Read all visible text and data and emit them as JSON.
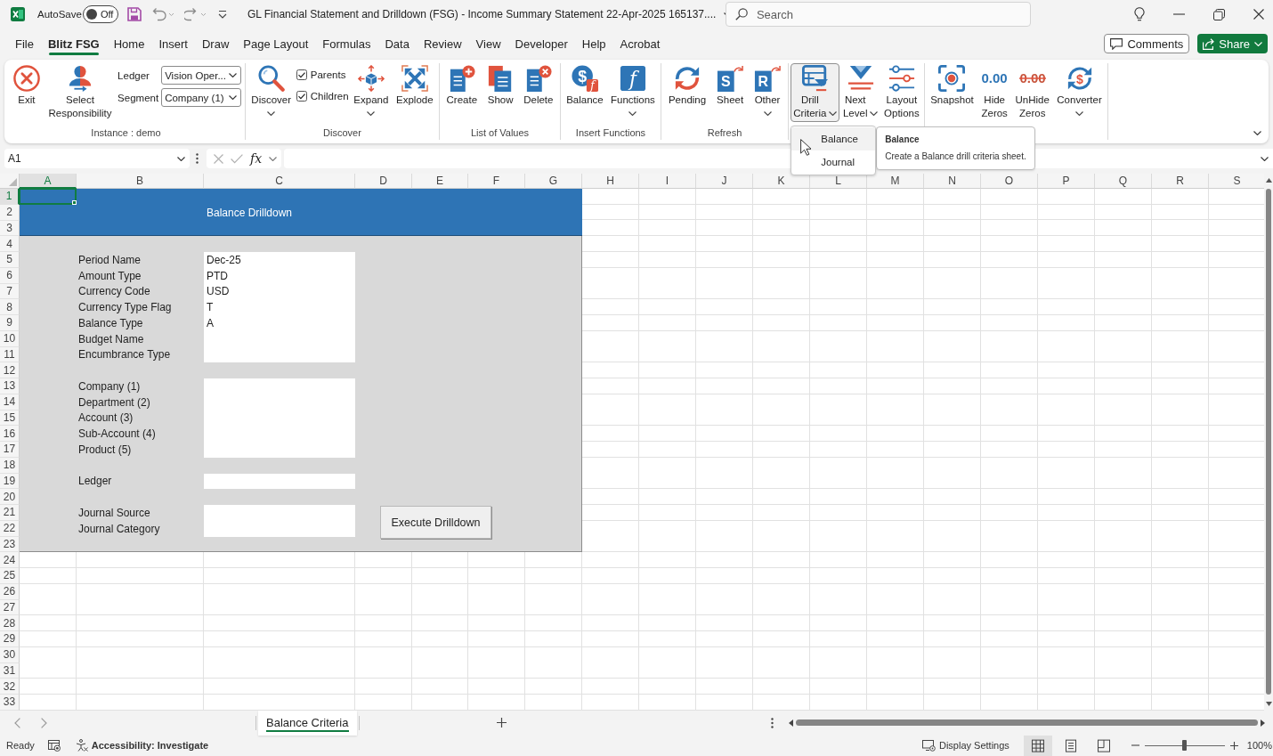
{
  "title_bar": {
    "autosave_label": "AutoSave",
    "autosave": {
      "label": "Off",
      "on": false
    },
    "title": "GL Financial Statement and Drilldown (FSG) - Income Summary Statement 22-Apr-2025 165137....",
    "search": {
      "placeholder": "Search"
    }
  },
  "menu_tabs": [
    {
      "label": "File",
      "selected": false
    },
    {
      "label": "Blitz FSG",
      "selected": true
    },
    {
      "label": "Home",
      "selected": false
    },
    {
      "label": "Insert",
      "selected": false
    },
    {
      "label": "Draw",
      "selected": false
    },
    {
      "label": "Page Layout",
      "selected": false
    },
    {
      "label": "Formulas",
      "selected": false
    },
    {
      "label": "Data",
      "selected": false
    },
    {
      "label": "Review",
      "selected": false
    },
    {
      "label": "View",
      "selected": false
    },
    {
      "label": "Developer",
      "selected": false
    },
    {
      "label": "Help",
      "selected": false
    },
    {
      "label": "Acrobat",
      "selected": false
    }
  ],
  "header_buttons": {
    "comments": "Comments",
    "share": "Share"
  },
  "ribbon": {
    "groups": [
      {
        "label": "Instance : demo",
        "items": [
          {
            "kind": "button",
            "label": "Exit",
            "expanded": false
          },
          {
            "kind": "button",
            "label": "Select Responsibility",
            "expanded": false
          },
          {
            "kind": "combos",
            "rows": [
              {
                "label": "Ledger",
                "value": "Vision Oper..."
              },
              {
                "label": "Segment",
                "value": "Company (1)"
              }
            ]
          }
        ]
      },
      {
        "label": "Discover",
        "items": [
          {
            "kind": "dropdown",
            "label": "Discover",
            "expanded": false
          },
          {
            "kind": "checks",
            "rows": [
              {
                "label": "Parents",
                "checked": true
              },
              {
                "label": "Children",
                "checked": true
              }
            ]
          },
          {
            "kind": "dropdown",
            "label": "Expand",
            "expanded": false
          },
          {
            "kind": "button",
            "label": "Explode",
            "expanded": false
          }
        ]
      },
      {
        "label": "List of Values",
        "items": [
          {
            "kind": "button",
            "label": "Create",
            "expanded": false
          },
          {
            "kind": "button",
            "label": "Show",
            "expanded": false
          },
          {
            "kind": "button",
            "label": "Delete",
            "expanded": false
          }
        ]
      },
      {
        "label": "Insert Functions",
        "items": [
          {
            "kind": "button",
            "label": "Balance",
            "expanded": false,
            "icon_glyphs": [
              "$",
              "f"
            ]
          },
          {
            "kind": "dropdown",
            "label": "Functions",
            "expanded": false,
            "icon_glyphs": [
              "f"
            ]
          }
        ]
      },
      {
        "label": "Refresh",
        "items": [
          {
            "kind": "button",
            "label": "Pending",
            "expanded": false
          },
          {
            "kind": "button",
            "label": "Sheet",
            "expanded": false,
            "icon_glyphs": [
              "S"
            ]
          },
          {
            "kind": "dropdown",
            "label": "Other",
            "expanded": false,
            "icon_glyphs": [
              "R"
            ]
          }
        ]
      },
      {
        "items": [
          {
            "kind": "dropdown_inline",
            "label": "Drill Criteria",
            "expanded": true,
            "menu": {
              "items": [
                {
                  "label": "Balance",
                  "selected": true
                },
                {
                  "label": "Journal",
                  "selected": false
                }
              ],
              "tooltip": {
                "title": "Balance",
                "text": "Create a Balance drill criteria sheet."
              }
            }
          },
          {
            "kind": "dropdown_inline",
            "label": "Next Level",
            "expanded": false
          },
          {
            "kind": "button",
            "label": "Layout Options",
            "expanded": false
          }
        ]
      },
      {
        "items": [
          {
            "kind": "button",
            "label": "Snapshot",
            "expanded": false
          },
          {
            "kind": "button",
            "label": "Hide Zeros",
            "expanded": false,
            "icon_glyphs": [
              "0.00"
            ]
          },
          {
            "kind": "button",
            "label": "UnHide Zeros",
            "expanded": false,
            "icon_glyphs": [
              "0.00"
            ]
          },
          {
            "kind": "dropdown",
            "label": "Converter",
            "expanded": false,
            "icon_glyphs": [
              "$"
            ]
          }
        ]
      }
    ]
  },
  "formula_bar": {
    "name_box": "A1",
    "function_button": "fx"
  },
  "sheet": {
    "columns": [
      {
        "label": "A",
        "selected": true
      },
      {
        "label": "B",
        "selected": false
      },
      {
        "label": "C",
        "selected": false
      },
      {
        "label": "D",
        "selected": false
      },
      {
        "label": "E",
        "selected": false
      },
      {
        "label": "F",
        "selected": false
      },
      {
        "label": "G",
        "selected": false
      },
      {
        "label": "H",
        "selected": false
      },
      {
        "label": "I",
        "selected": false
      },
      {
        "label": "J",
        "selected": false
      },
      {
        "label": "K",
        "selected": false
      },
      {
        "label": "L",
        "selected": false
      },
      {
        "label": "M",
        "selected": false
      },
      {
        "label": "N",
        "selected": false
      },
      {
        "label": "O",
        "selected": false
      },
      {
        "label": "P",
        "selected": false
      },
      {
        "label": "Q",
        "selected": false
      },
      {
        "label": "R",
        "selected": false
      },
      {
        "label": "S",
        "selected": false
      }
    ],
    "rows": [
      {
        "label": "1",
        "selected": true
      },
      {
        "label": "2",
        "selected": false
      },
      {
        "label": "3",
        "selected": false
      },
      {
        "label": "4",
        "selected": false
      },
      {
        "label": "5",
        "selected": false
      },
      {
        "label": "6",
        "selected": false
      },
      {
        "label": "7",
        "selected": false
      },
      {
        "label": "8",
        "selected": false
      },
      {
        "label": "9",
        "selected": false
      },
      {
        "label": "10",
        "selected": false
      },
      {
        "label": "11",
        "selected": false
      },
      {
        "label": "12",
        "selected": false
      },
      {
        "label": "13",
        "selected": false
      },
      {
        "label": "14",
        "selected": false
      },
      {
        "label": "15",
        "selected": false
      },
      {
        "label": "16",
        "selected": false
      },
      {
        "label": "17",
        "selected": false
      },
      {
        "label": "18",
        "selected": false
      },
      {
        "label": "19",
        "selected": false
      },
      {
        "label": "20",
        "selected": false
      },
      {
        "label": "21",
        "selected": false
      },
      {
        "label": "22",
        "selected": false
      },
      {
        "label": "23",
        "selected": false
      },
      {
        "label": "24",
        "selected": false
      },
      {
        "label": "25",
        "selected": false
      },
      {
        "label": "26",
        "selected": false
      },
      {
        "label": "27",
        "selected": false
      },
      {
        "label": "28",
        "selected": false
      },
      {
        "label": "29",
        "selected": false
      },
      {
        "label": "30",
        "selected": false
      },
      {
        "label": "31",
        "selected": false
      },
      {
        "label": "32",
        "selected": false
      },
      {
        "label": "33",
        "selected": false
      }
    ],
    "form": {
      "title": "Balance Drilldown",
      "field_groups": [
        {
          "fields": [
            {
              "label": "Period Name",
              "value": "Dec-25"
            },
            {
              "label": "Amount Type",
              "value": "PTD"
            },
            {
              "label": "Currency Code",
              "value": "USD"
            },
            {
              "label": "Currency Type Flag",
              "value": "T"
            },
            {
              "label": "Balance Type",
              "value": "A"
            },
            {
              "label": "Budget Name"
            },
            {
              "label": "Encumbrance Type"
            }
          ]
        },
        {
          "fields": [
            {
              "label": "Company (1)"
            },
            {
              "label": "Department (2)"
            },
            {
              "label": "Account (3)"
            },
            {
              "label": "Sub-Account (4)"
            },
            {
              "label": "Product (5)"
            }
          ]
        },
        {
          "fields": [
            {
              "label": "Ledger"
            }
          ]
        },
        {
          "fields": [
            {
              "label": "Journal Source"
            },
            {
              "label": "Journal Category"
            }
          ]
        }
      ],
      "execute_button": "Execute Drilldown"
    }
  },
  "sheet_tabs": [
    {
      "label": "Balance Criteria",
      "selected": true
    }
  ],
  "status_bar": {
    "status": "Ready",
    "accessibility": "Accessibility: Investigate",
    "display_settings": "Display Settings",
    "views": [
      {
        "kind": "normal",
        "selected": true
      },
      {
        "kind": "layout",
        "selected": false
      },
      {
        "kind": "pagebreak",
        "selected": false
      }
    ],
    "zoom": {
      "level": 0.5,
      "reading": "100%"
    }
  }
}
